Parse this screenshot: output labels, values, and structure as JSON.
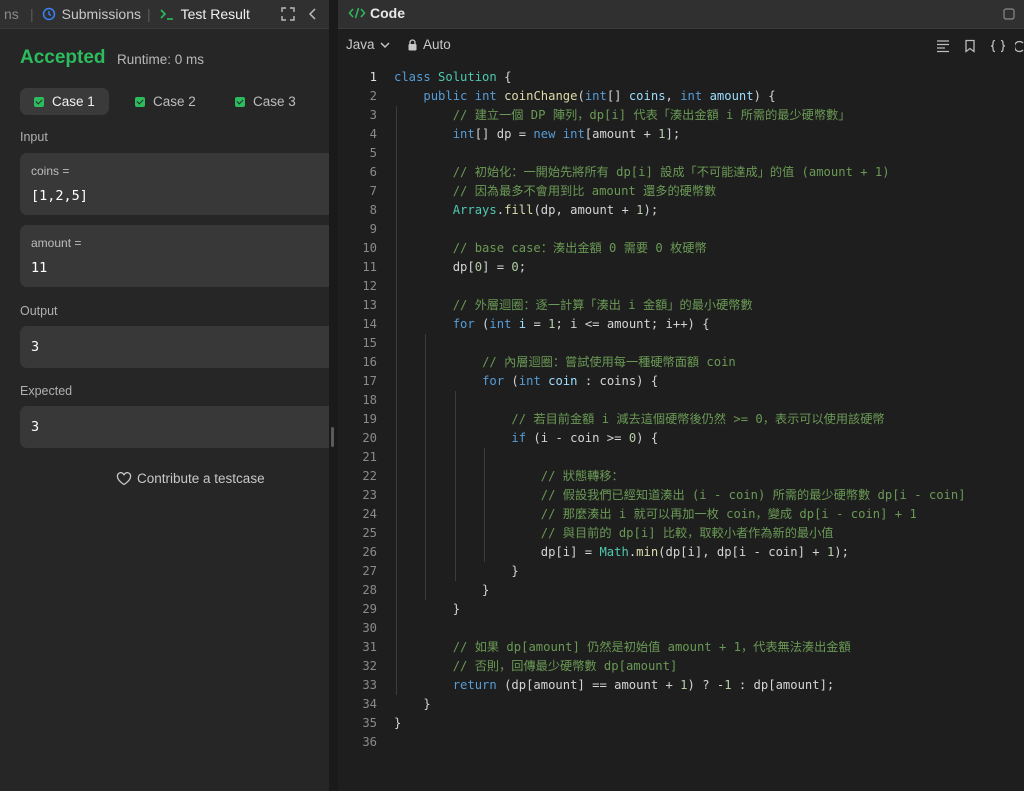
{
  "tabs": {
    "partial_label": "ns",
    "submissions_label": "Submissions",
    "test_result_label": "Test Result"
  },
  "result": {
    "status": "Accepted",
    "runtime": "Runtime: 0 ms"
  },
  "cases": [
    {
      "label": "Case 1"
    },
    {
      "label": "Case 2"
    },
    {
      "label": "Case 3"
    }
  ],
  "input": {
    "label": "Input",
    "coins_name": "coins =",
    "coins_value": "[1,2,5]",
    "amount_name": "amount =",
    "amount_value": "11"
  },
  "output": {
    "label": "Output",
    "value": "3"
  },
  "expected": {
    "label": "Expected",
    "value": "3"
  },
  "contribute_label": "Contribute a testcase",
  "editor": {
    "title": "Code",
    "language": "Java",
    "mode": "Auto"
  },
  "code_lines": [
    "class Solution {",
    "    public int coinChange(int[] coins, int amount) {",
    "        // 建立一個 DP 陣列，dp[i] 代表「湊出金額 i 所需的最少硬幣數」",
    "        int[] dp = new int[amount + 1];",
    "",
    "        // 初始化：一開始先將所有 dp[i] 設成「不可能達成」的值 (amount + 1)",
    "        // 因為最多不會用到比 amount 還多的硬幣數",
    "        Arrays.fill(dp, amount + 1);",
    "",
    "        // base case：湊出金額 0 需要 0 枚硬幣",
    "        dp[0] = 0;",
    "",
    "        // 外層迴圈：逐一計算「湊出 i 金額」的最小硬幣數",
    "        for (int i = 1; i <= amount; i++) {",
    "",
    "            // 內層迴圈：嘗試使用每一種硬幣面額 coin",
    "            for (int coin : coins) {",
    "",
    "                // 若目前金額 i 減去這個硬幣後仍然 >= 0，表示可以使用該硬幣",
    "                if (i - coin >= 0) {",
    "",
    "                    // 狀態轉移：",
    "                    // 假設我們已經知道湊出 (i - coin) 所需的最少硬幣數 dp[i - coin]",
    "                    // 那麼湊出 i 就可以再加一枚 coin，變成 dp[i - coin] + 1",
    "                    // 與目前的 dp[i] 比較，取較小者作為新的最小值",
    "                    dp[i] = Math.min(dp[i], dp[i - coin] + 1);",
    "                }",
    "            }",
    "        }",
    "",
    "        // 如果 dp[amount] 仍然是初始值 amount + 1，代表無法湊出金額",
    "        // 否則，回傳最少硬幣數 dp[amount]",
    "        return (dp[amount] == amount + 1) ? -1 : dp[amount];",
    "    }",
    "}",
    ""
  ],
  "colors": {
    "accepted": "#2cbb5d",
    "keyword": "#569cd6",
    "type": "#4ec9b0",
    "function": "#dcdcaa",
    "variable": "#9cdcfe",
    "number": "#b5cea8",
    "comment": "#6a9955"
  },
  "icons": [
    "clock-icon",
    "terminal-icon",
    "fullscreen-icon",
    "collapse-left-icon",
    "checkbox-icon",
    "heart-icon",
    "code-icon",
    "chevron-down-icon",
    "lock-icon",
    "format-icon",
    "bookmark-icon",
    "braces-icon",
    "reset-icon"
  ]
}
